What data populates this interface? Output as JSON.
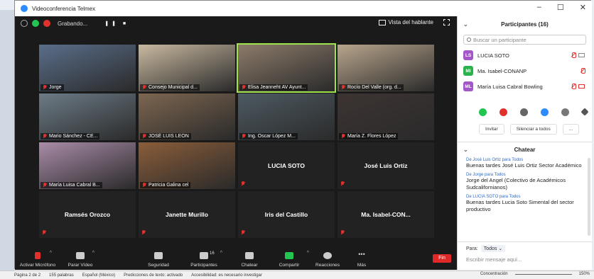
{
  "window": {
    "title": "Videoconferencia Telmex"
  },
  "meeting": {
    "recording_label": "Grabando...",
    "speaker_view_label": "Vista del hablante",
    "tiles": [
      {
        "name": "Jorge",
        "video": true,
        "bg": "#5a6e8a"
      },
      {
        "name": "Consejo Municipal d...",
        "video": true,
        "bg": "#c9b9a0"
      },
      {
        "name": "Elisa Jeanneht AV Ayunt...",
        "video": true,
        "bg": "#8c7b6a",
        "active": true
      },
      {
        "name": "Rocío Del Valle (org. d...",
        "video": true,
        "bg": "#b8a58c"
      },
      {
        "name": "Mario Sánchez - CE...",
        "video": true,
        "bg": "#6c7b86"
      },
      {
        "name": "JOSÉ LUIS LEÓN",
        "video": true,
        "bg": "#7d6650"
      },
      {
        "name": "Ing. Oscar López M...",
        "video": true,
        "bg": "#4d5a62"
      },
      {
        "name": "María Z. Flores López",
        "video": true,
        "bg": "#3c3432"
      },
      {
        "name": "María Luisa Cabral B...",
        "video": true,
        "bg": "#a98ca8"
      },
      {
        "name": "Patricia Galina cel",
        "video": true,
        "bg": "#8a5d3a"
      },
      {
        "name": "LUCIA SOTO",
        "video": false
      },
      {
        "name": "José Luis Ortiz",
        "video": false
      },
      {
        "name": "Ramsés Orozco",
        "video": false
      },
      {
        "name": "Janette Murillo",
        "video": false
      },
      {
        "name": "Iris del Castillo",
        "video": false
      },
      {
        "name": "Ma. Isabel-CON...",
        "video": false
      }
    ],
    "toolbar": {
      "mic": "Activar Micrófono",
      "video": "Parar Vídeo",
      "security": "Seguridad",
      "participants": "Participantes",
      "participants_count": "16",
      "chat": "Chatear",
      "share": "Compartir",
      "reactions": "Reacciones",
      "more": "Más",
      "end": "Fin"
    }
  },
  "participants_panel": {
    "title": "Participantes (16)",
    "search_placeholder": "Buscar un participante",
    "rows": [
      {
        "initials": "LS",
        "name": "LUCIA SOTO",
        "color": "#a457c9"
      },
      {
        "initials": "MI",
        "name": "Ma. Isabel-CONANP",
        "color": "#2bb24c"
      },
      {
        "initials": "ML",
        "name": "María Luisa Cabral Bowling",
        "color": "#a457c9"
      }
    ],
    "invite": "Invitar",
    "mute_all": "Silenciar a todos",
    "more": "..."
  },
  "chat": {
    "title": "Chatear",
    "messages": [
      {
        "from": "De José Luis Ortiz para Todos",
        "text": "Buenas tardes José Luis Ortiz Sector Académico"
      },
      {
        "from": "De Jorge para Todos",
        "text": "Jorge del Angel (Colectivo de Académicos Sudcalifornianos)"
      },
      {
        "from": "De LUCIA SOTO para Todos",
        "text": "Buenas tardes Lucia Soto Simental del sector productivo"
      }
    ],
    "to_label": "Para:",
    "to_value": "Todos",
    "compose_placeholder": "Escribir mensaje aquí..."
  },
  "statusbar": {
    "page": "Página 2 de 2",
    "words": "155 palabras",
    "language": "Español (México)",
    "predictions": "Predicciones de texto: activado",
    "accessibility": "Accesibilidad: es necesario investigar",
    "focus": "Concentración",
    "zoom": "150%"
  }
}
